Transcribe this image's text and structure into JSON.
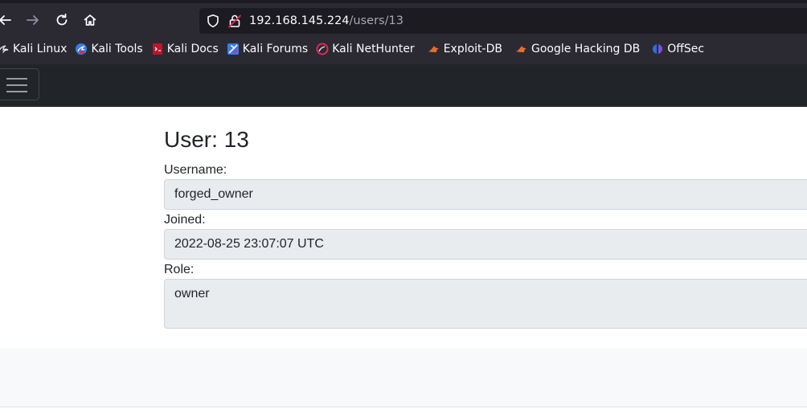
{
  "browser": {
    "url": {
      "host": "192.168.145.224",
      "path": "/users/13"
    },
    "bookmarks": [
      {
        "label": "Kali Linux",
        "icon": "kali-dragon-icon"
      },
      {
        "label": "Kali Tools",
        "icon": "kali-tools-icon"
      },
      {
        "label": "Kali Docs",
        "icon": "kali-docs-icon"
      },
      {
        "label": "Kali Forums",
        "icon": "kali-forums-icon"
      },
      {
        "label": "Kali NetHunter",
        "icon": "kali-nethunter-icon"
      },
      {
        "label": "Exploit-DB",
        "icon": "exploit-db-icon"
      },
      {
        "label": "Google Hacking DB",
        "icon": "ghdb-icon"
      },
      {
        "label": "OffSec",
        "icon": "offsec-icon"
      }
    ]
  },
  "page": {
    "title": "User: 13",
    "fields": {
      "username": {
        "label": "Username:",
        "value": "forged_owner"
      },
      "joined": {
        "label": "Joined:",
        "value": "2022-08-25 23:07:07 UTC"
      },
      "role": {
        "label": "Role:",
        "value": "owner"
      }
    }
  },
  "colors": {
    "chrome": "#2b2a33",
    "urlbar": "#1c1b22",
    "navbar": "#212529",
    "field_bg": "#e9ecef",
    "footer_bg": "#f8f9fa"
  }
}
